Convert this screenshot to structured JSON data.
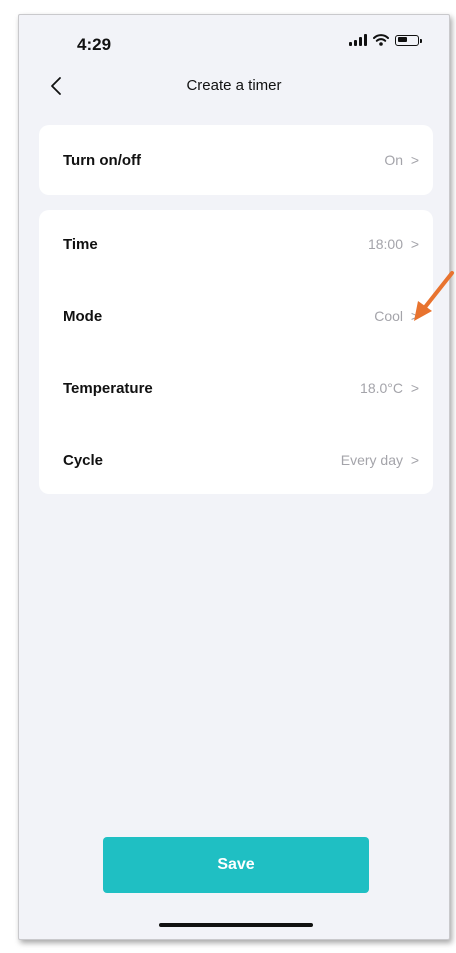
{
  "status_bar": {
    "time": "4:29"
  },
  "header": {
    "title": "Create a timer",
    "back_icon": "chevron-left-icon"
  },
  "power_card": {
    "label": "Turn on/off",
    "value": "On"
  },
  "settings": [
    {
      "label": "Time",
      "value": "18:00"
    },
    {
      "label": "Mode",
      "value": "Cool"
    },
    {
      "label": "Temperature",
      "value": "18.0°C"
    },
    {
      "label": "Cycle",
      "value": "Every day"
    }
  ],
  "save_label": "Save",
  "colors": {
    "accent": "#1fbfc3",
    "background": "#f2f3f8",
    "annotation_arrow": "#e8732f"
  }
}
